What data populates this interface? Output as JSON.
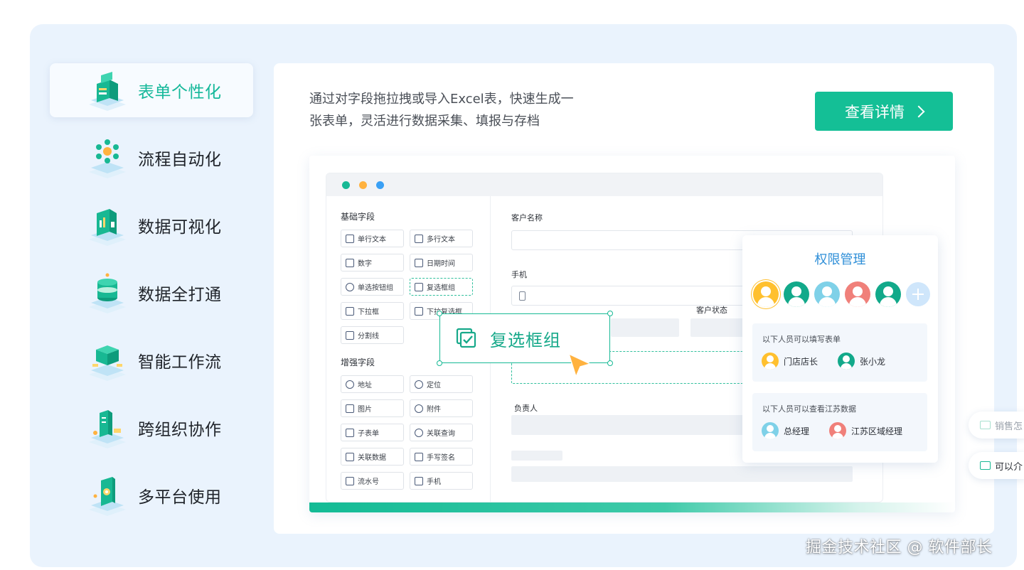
{
  "nav": {
    "items": [
      {
        "label": "表单个性化",
        "icon": "form-iso-icon",
        "active": true
      },
      {
        "label": "流程自动化",
        "icon": "flow-iso-icon",
        "active": false
      },
      {
        "label": "数据可视化",
        "icon": "chart-iso-icon",
        "active": false
      },
      {
        "label": "数据全打通",
        "icon": "database-iso-icon",
        "active": false
      },
      {
        "label": "智能工作流",
        "icon": "workflow-iso-icon",
        "active": false
      },
      {
        "label": "跨组织协作",
        "icon": "collab-iso-icon",
        "active": false
      },
      {
        "label": "多平台使用",
        "icon": "multiplatform-iso-icon",
        "active": false
      }
    ]
  },
  "main": {
    "description_line1": "通过对字段拖拉拽或导入Excel表，快速生成一",
    "description_line2": "张表单，灵活进行数据采集、填报与存档",
    "detail_button": "查看详情"
  },
  "builder": {
    "basic_title": "基础字段",
    "basic_fields": [
      "单行文本",
      "多行文本",
      "数字",
      "日期时间",
      "单选按钮组",
      "复选框组",
      "下拉框",
      "下拉复选框",
      "分割线"
    ],
    "enhanced_title": "增强字段",
    "enhanced_fields": [
      "地址",
      "定位",
      "图片",
      "附件",
      "子表单",
      "关联查询",
      "关联数据",
      "手写签名",
      "流水号",
      "手机"
    ],
    "form_labels": {
      "customer_name": "客户名称",
      "phone": "手机",
      "customer_status": "客户状态",
      "owner": "负责人"
    },
    "drag_label": "复选框组"
  },
  "permissions": {
    "title": "权限管理",
    "fill_title": "以下人员可以填写表单",
    "fill_people": [
      "门店店长",
      "张小龙"
    ],
    "view_title": "以下人员可以查看江苏数据",
    "view_people": [
      "总经理",
      "江苏区域经理"
    ]
  },
  "chat": {
    "tab1": "销售怎",
    "tab2": "可以介"
  },
  "watermark": "掘金技术社区 @ 软件部长",
  "colors": {
    "accent": "#14bf96",
    "nav_active": "#15b89a",
    "perm_title": "#2f8fd8",
    "bg_panel": "#eaf3fd"
  }
}
